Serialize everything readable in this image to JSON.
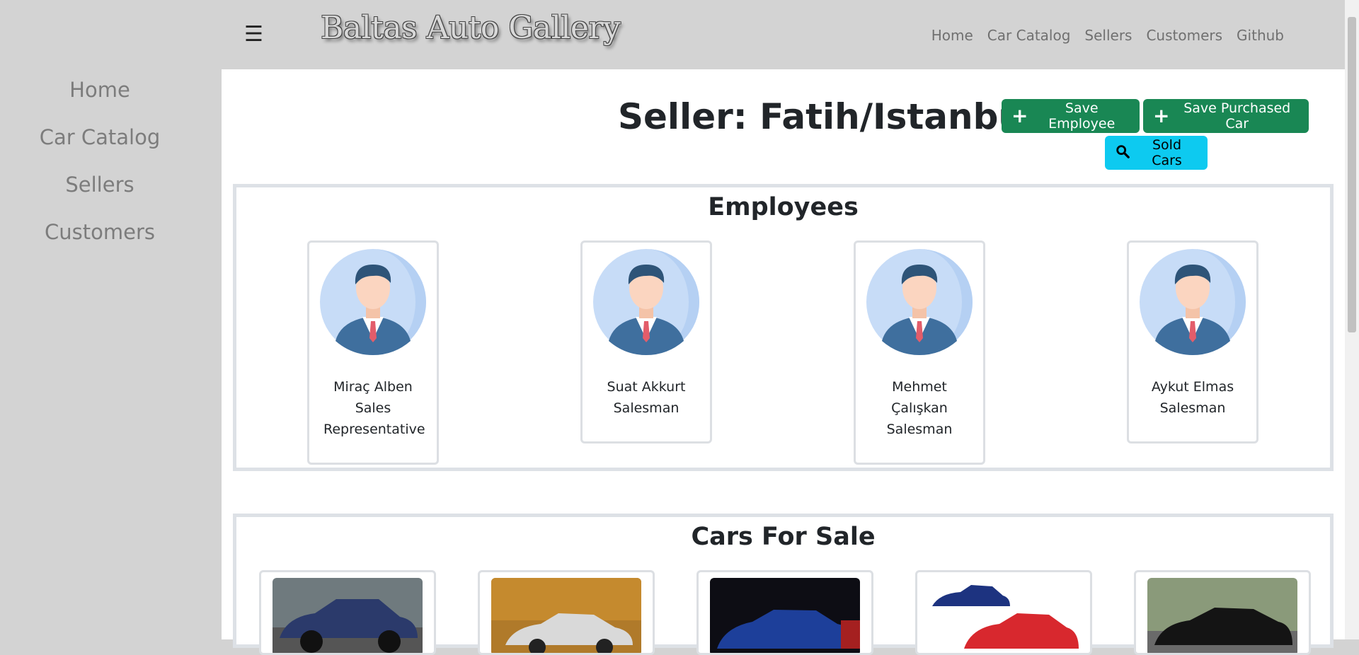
{
  "app": {
    "brand": "Baltas Auto Gallery",
    "menu_icon": "☰"
  },
  "topnav": [
    "Home",
    "Car Catalog",
    "Sellers",
    "Customers",
    "Github"
  ],
  "sidebar": [
    "Home",
    "Car Catalog",
    "Sellers",
    "Customers"
  ],
  "page": {
    "title": "Seller: Fatih/Istanbul"
  },
  "buttons": {
    "save_employee": "Save Employee",
    "save_purchased_car": "Save Purchased Car",
    "sold_cars": "Sold Cars"
  },
  "employees_section": {
    "title": "Employees",
    "items": [
      {
        "name": "Miraç Alben",
        "role": "Sales Representative"
      },
      {
        "name": "Suat Akkurt",
        "role": "Salesman"
      },
      {
        "name": "Mehmet Çalışkan",
        "role": "Salesman"
      },
      {
        "name": "Aykut Elmas",
        "role": "Salesman"
      }
    ]
  },
  "cars_section": {
    "title": "Cars For Sale",
    "items": [
      {
        "image": "dark blue muscle car",
        "color": "#2b3a6b",
        "bg": "#6f7a7e"
      },
      {
        "image": "silver sports car autumn",
        "color": "#d9d9d9",
        "bg": "#b07a2a"
      },
      {
        "image": "blue sports car night",
        "color": "#1d3f9a",
        "bg": "#0d0d14"
      },
      {
        "image": "red and blue sports cars",
        "color": "#d8282e",
        "bg": "#ffffff"
      },
      {
        "image": "black sports car",
        "color": "#141414",
        "bg": "#8a9a7a"
      }
    ]
  },
  "colors": {
    "accent_green": "#198754",
    "accent_cyan": "#0dcaf0"
  }
}
